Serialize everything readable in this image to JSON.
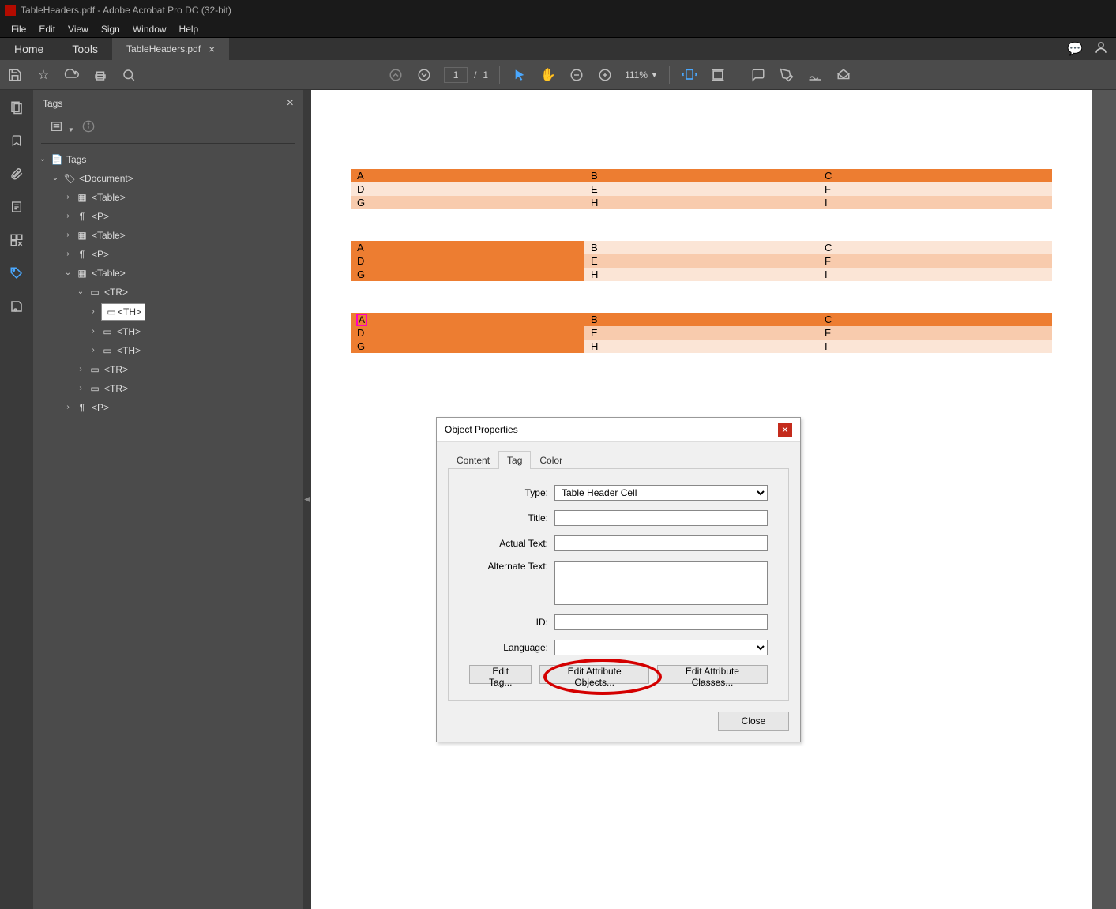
{
  "titlebar": {
    "filename": "TableHeaders.pdf",
    "appname": "Adobe Acrobat Pro DC (32-bit)"
  },
  "menubar": [
    "File",
    "Edit",
    "View",
    "Sign",
    "Window",
    "Help"
  ],
  "tabs": {
    "home": "Home",
    "tools": "Tools",
    "doc": "TableHeaders.pdf"
  },
  "toolbar": {
    "page_current": "1",
    "page_total": "1",
    "zoom": "111%"
  },
  "tags_panel": {
    "title": "Tags",
    "root": "Tags",
    "nodes": {
      "document": "<Document>",
      "table": "<Table>",
      "p": "<P>",
      "tr": "<TR>",
      "th": "<TH>"
    }
  },
  "doc_tables": {
    "table1": {
      "head": [
        "A",
        "B",
        "C"
      ],
      "rows": [
        [
          "D",
          "E",
          "F"
        ],
        [
          "G",
          "H",
          "I"
        ]
      ]
    },
    "table2": {
      "rows": [
        [
          "A",
          "B",
          "C"
        ],
        [
          "D",
          "E",
          "F"
        ],
        [
          "G",
          "H",
          "I"
        ]
      ]
    },
    "table3": {
      "head": [
        "A",
        "B",
        "C"
      ],
      "rows": [
        [
          "D",
          "E",
          "F"
        ],
        [
          "G",
          "H",
          "I"
        ]
      ]
    }
  },
  "dialog": {
    "title": "Object Properties",
    "tabs": {
      "content": "Content",
      "tag": "Tag",
      "color": "Color"
    },
    "labels": {
      "type": "Type:",
      "title": "Title:",
      "actual": "Actual Text:",
      "alt": "Alternate Text:",
      "id": "ID:",
      "lang": "Language:"
    },
    "values": {
      "type": "Table Header Cell",
      "title": "",
      "actual": "",
      "alt": "",
      "id": "",
      "lang": ""
    },
    "buttons": {
      "edit_tag": "Edit Tag...",
      "edit_attr_objects": "Edit Attribute Objects...",
      "edit_attr_classes": "Edit Attribute Classes...",
      "close": "Close"
    }
  }
}
